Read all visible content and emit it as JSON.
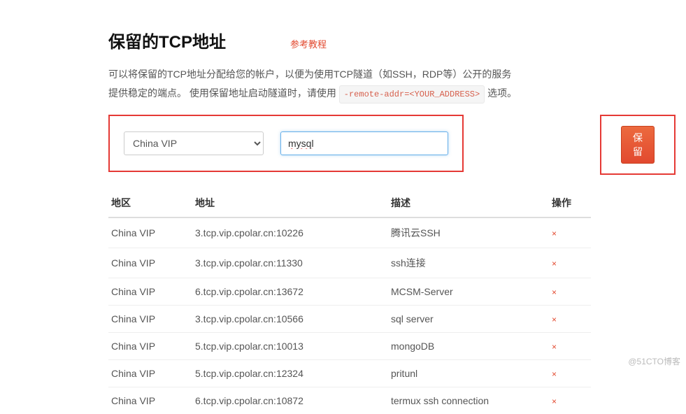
{
  "header": {
    "title": "保留的TCP地址",
    "tutorial_link": "参考教程"
  },
  "description": {
    "line1": "可以将保留的TCP地址分配给您的帐户，以便为使用TCP隧道（如SSH，RDP等）公开的服务",
    "line2_a": "提供稳定的端点。 使用保留地址启动隧道时，请使用 ",
    "code": "-remote-addr=<YOUR_ADDRESS>",
    "line2_b": " 选项。"
  },
  "form": {
    "region_value": "China VIP",
    "desc_value": "mysql",
    "reserve_label": "保留"
  },
  "table": {
    "headers": {
      "region": "地区",
      "address": "地址",
      "description": "描述",
      "action": "操作"
    },
    "rows": [
      {
        "region": "China VIP",
        "address": "3.tcp.vip.cpolar.cn:10226",
        "description": "腾讯云SSH"
      },
      {
        "region": "China VIP",
        "address": "3.tcp.vip.cpolar.cn:11330",
        "description": "ssh连接"
      },
      {
        "region": "China VIP",
        "address": "6.tcp.vip.cpolar.cn:13672",
        "description": "MCSM-Server"
      },
      {
        "region": "China VIP",
        "address": "3.tcp.vip.cpolar.cn:10566",
        "description": "sql server"
      },
      {
        "region": "China VIP",
        "address": "5.tcp.vip.cpolar.cn:10013",
        "description": "mongoDB"
      },
      {
        "region": "China VIP",
        "address": "5.tcp.vip.cpolar.cn:12324",
        "description": "pritunl"
      },
      {
        "region": "China VIP",
        "address": "6.tcp.vip.cpolar.cn:10872",
        "description": "termux ssh connection"
      }
    ]
  },
  "watermark": "@51CTO博客"
}
